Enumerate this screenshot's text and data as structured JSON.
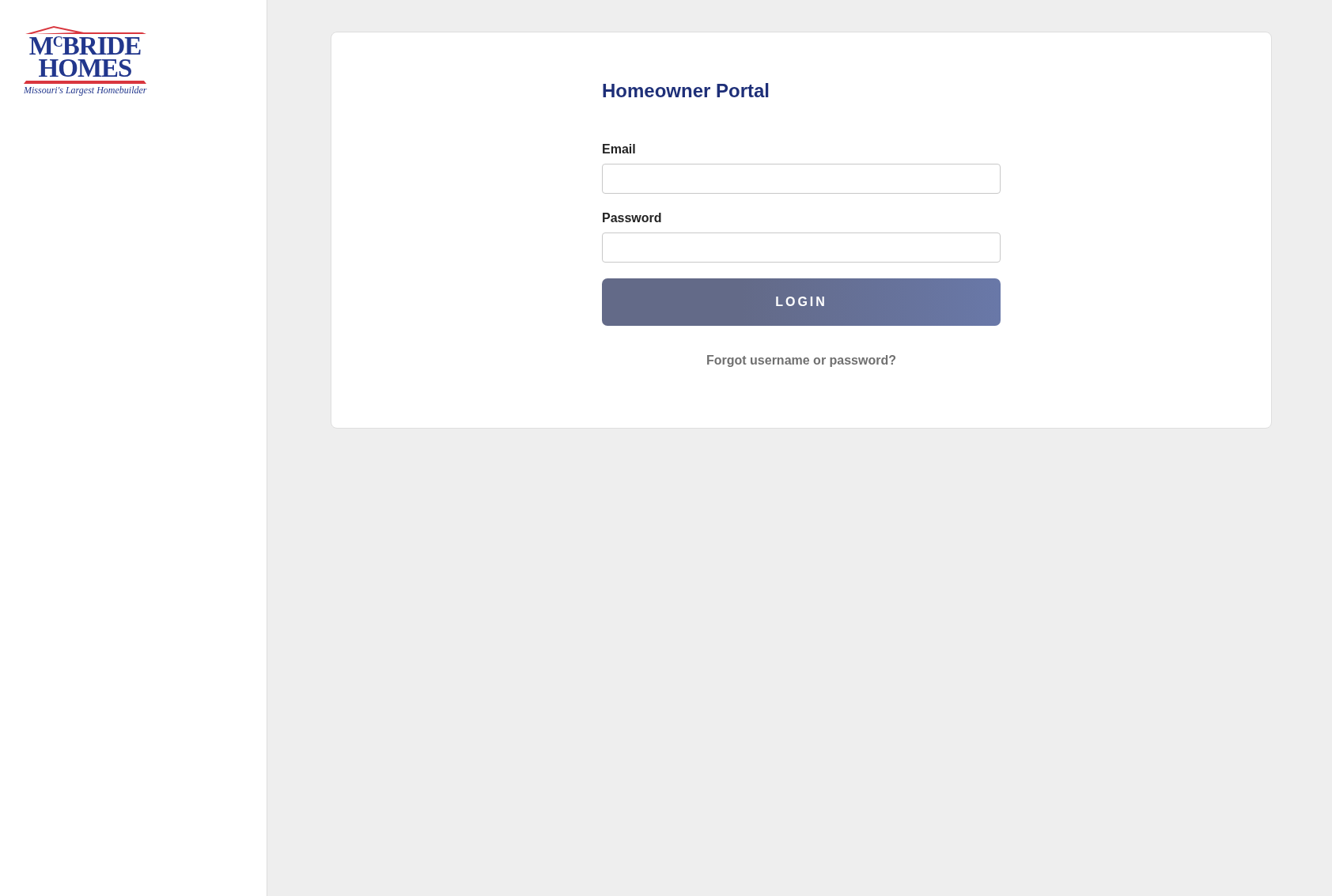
{
  "logo": {
    "line_1": "M$^{C}$BRIDE",
    "line_2": "HOMES",
    "tagline": "Missouri's Largest Homebuilder"
  },
  "login": {
    "title": "Homeowner Portal",
    "fields": [
      {
        "label": "Email"
      },
      {
        "label": "Password"
      }
    ],
    "button": "LOGIN",
    "forgot_link": "Forgot username or password?"
  }
}
